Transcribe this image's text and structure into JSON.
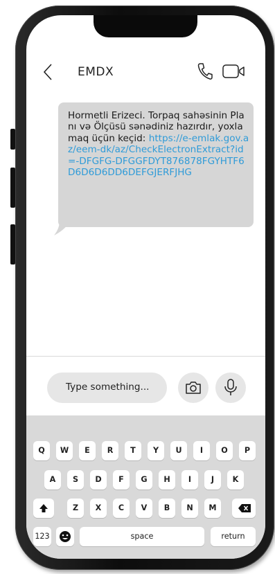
{
  "header": {
    "back_icon": "chevron-left-icon",
    "contact_name": "EMDX",
    "call_icon": "phone-icon",
    "video_icon": "video-camera-icon"
  },
  "message": {
    "text_plain": "Hormetli Erizeci. Torpaq sahəsinin Planı və Ölçüsü sənədiniz hazırdır, yoxlamaq üçün keçid:",
    "link_text": "https://e-emlak.gov.az/eem-dk/az/CheckElectronExtract?id=-DFGFG-DFGGFDYT876878FGYHTF6D6D6D6DD6DEFGJERFJHG"
  },
  "compose": {
    "placeholder": "Type something...",
    "camera_icon": "camera-icon",
    "mic_icon": "microphone-icon"
  },
  "keyboard": {
    "row1": [
      "Q",
      "W",
      "E",
      "R",
      "T",
      "Y",
      "U",
      "I",
      "O",
      "P"
    ],
    "row2": [
      "A",
      "S",
      "D",
      "F",
      "G",
      "H",
      "I",
      "J",
      "K"
    ],
    "row3": [
      "Z",
      "X",
      "C",
      "V",
      "B",
      "N",
      "M"
    ],
    "shift_icon": "shift-icon",
    "backspace_icon": "backspace-icon",
    "numbers_label": "123",
    "emoji_icon": "emoji-icon",
    "space_label": "space",
    "return_label": "return"
  }
}
